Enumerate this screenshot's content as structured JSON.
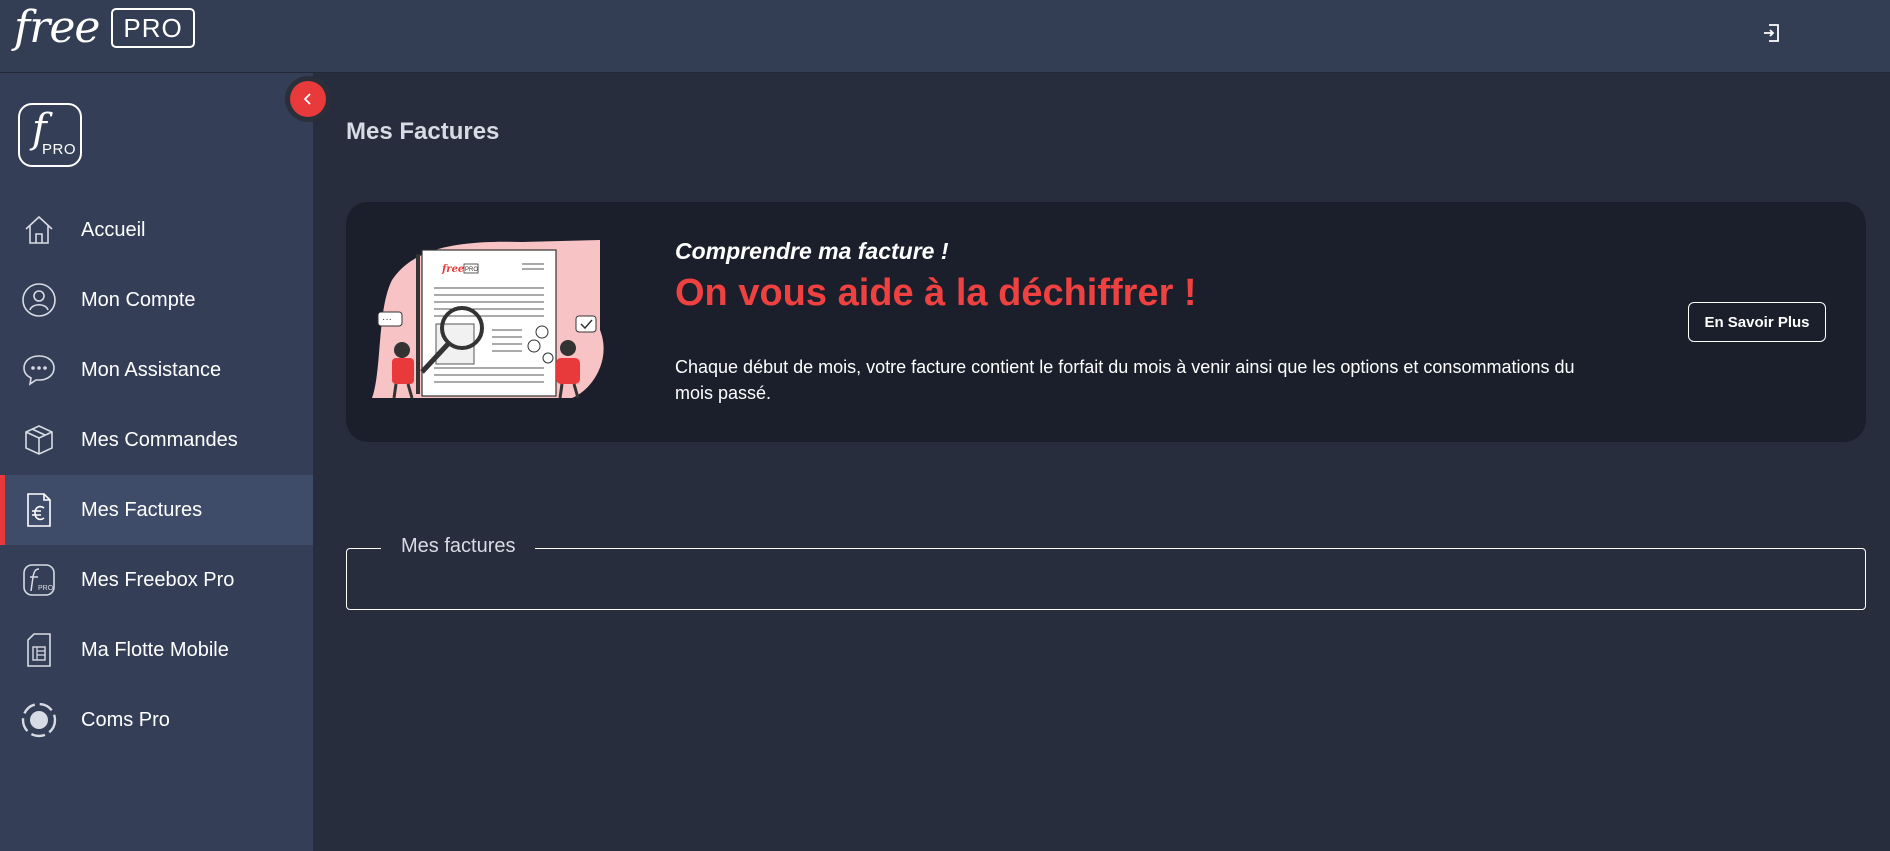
{
  "brand": {
    "logo_word": "free",
    "logo_badge": "PRO",
    "side_logo_letter": "f",
    "side_logo_badge": "PRO"
  },
  "header": {
    "logout_icon": "logout-icon"
  },
  "sidebar": {
    "items": [
      {
        "label": "Accueil",
        "icon": "home-icon"
      },
      {
        "label": "Mon Compte",
        "icon": "user-icon"
      },
      {
        "label": "Mon Assistance",
        "icon": "chat-icon"
      },
      {
        "label": "Mes Commandes",
        "icon": "package-icon"
      },
      {
        "label": "Mes Factures",
        "icon": "invoice-euro-icon",
        "active": true
      },
      {
        "label": "Mes Freebox Pro",
        "icon": "freebox-pro-icon"
      },
      {
        "label": "Ma Flotte Mobile",
        "icon": "sim-card-icon"
      },
      {
        "label": "Coms Pro",
        "icon": "coms-pro-icon"
      }
    ],
    "collapse_icon": "chevron-left-icon"
  },
  "main": {
    "title": "Mes Factures",
    "banner": {
      "subtitle": "Comprendre ma facture !",
      "title": "On vous aide à la déchiffrer !",
      "text": "Chaque début de mois, votre facture contient le forfait du mois à venir ainsi que les options et consommations du mois passé.",
      "button": "En Savoir Plus",
      "illustration_brand": "free",
      "illustration_badge": "PRO"
    },
    "factures_section": {
      "legend": "Mes factures"
    }
  },
  "colors": {
    "accent": "#e83a3a",
    "title_red": "#f04141",
    "sidebar": "#343f57",
    "topbar": "#333e54",
    "background": "#272d3d",
    "banner": "#1b1f2b"
  }
}
